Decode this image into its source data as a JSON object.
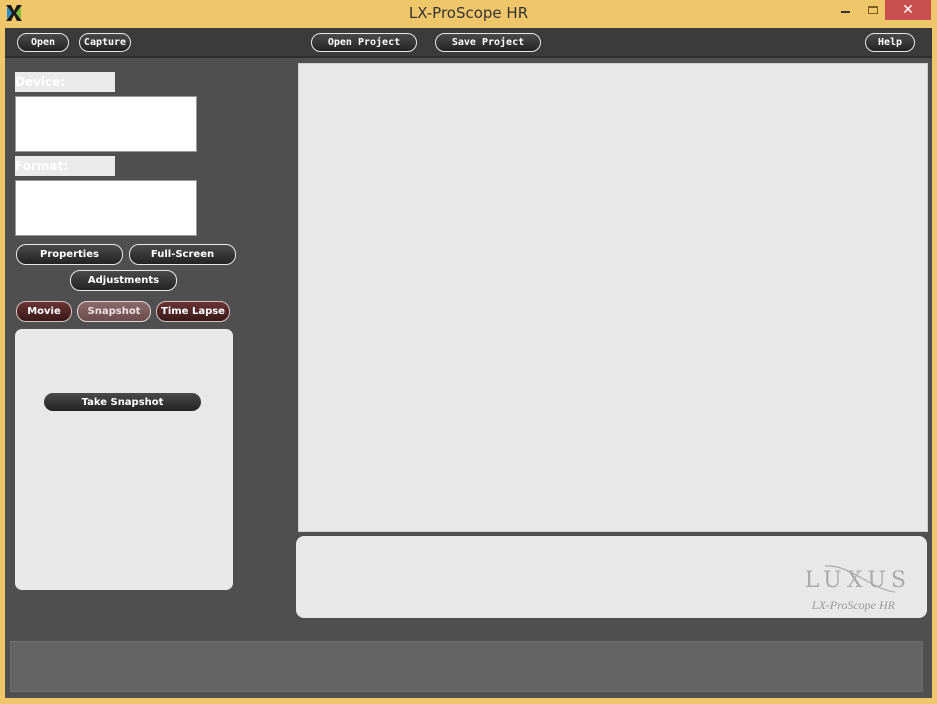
{
  "window": {
    "title": "LX-ProScope HR",
    "icon": "luxus-x-logo-icon",
    "controls": {
      "minimize": "minimize-icon",
      "maximize": "maximize-icon",
      "close": "✕"
    }
  },
  "toolbar": {
    "open_label": "Open",
    "capture_label": "Capture",
    "open_project_label": "Open Project",
    "save_project_label": "Save Project",
    "help_label": "Help"
  },
  "sidebar": {
    "device_label": "Device:",
    "device_value": "",
    "format_label": "Format:",
    "format_value": "",
    "properties_label": "Properties",
    "fullscreen_label": "Full-Screen",
    "adjustments_label": "Adjustments",
    "modes": [
      {
        "label": "Movie",
        "active": false
      },
      {
        "label": "Snapshot",
        "active": true
      },
      {
        "label": "Time Lapse",
        "active": false
      }
    ],
    "take_snapshot_label": "Take Snapshot"
  },
  "branding": {
    "logo": "LUXUS",
    "product": "LX-ProScope HR"
  },
  "colors": {
    "titlebar": "#f0c66a",
    "close_button": "#c7504f",
    "client_bg": "#4f4f4f",
    "toolbar_bg": "#3b3b3b",
    "panel_bg": "#e8e8e8",
    "mode_button": "#4a2525",
    "mode_active": "#7a5c5c"
  }
}
